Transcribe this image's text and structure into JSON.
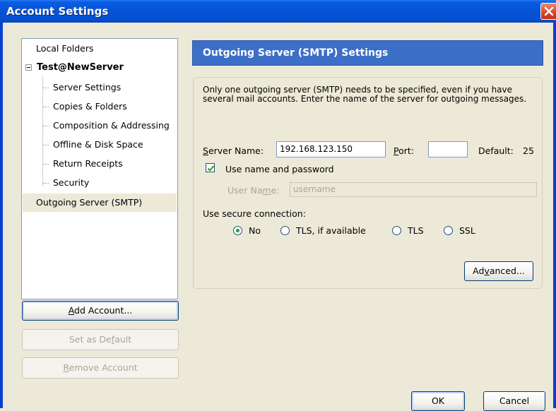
{
  "window": {
    "title": "Account Settings"
  },
  "tree": {
    "local_folders": "Local Folders",
    "account": "Test@NewServer",
    "children": [
      "Server Settings",
      "Copies & Folders",
      "Composition & Addressing",
      "Offline & Disk Space",
      "Return Receipts",
      "Security"
    ],
    "outgoing": "Outgoing Server (SMTP)"
  },
  "left_buttons": {
    "add_account": {
      "pre": "",
      "key": "A",
      "post": "dd Account..."
    },
    "set_default": {
      "pre": "Set as De",
      "key": "f",
      "post": "ault"
    },
    "remove_account": {
      "pre": "",
      "key": "R",
      "post": "emove Account"
    }
  },
  "panel": {
    "header": "Outgoing Server (SMTP) Settings",
    "description": "Only one outgoing server (SMTP) needs to be specified, even if you have several mail accounts. Enter the name of the server for outgoing messages.",
    "server_name_label": {
      "key": "S",
      "rest": "erver Name:"
    },
    "server_name_value": "192.168.123.150",
    "port_label": {
      "key": "P",
      "rest": "ort:"
    },
    "port_value": "",
    "default_label": "Default:",
    "default_value": "25",
    "use_name_password": "Use name and password",
    "use_name_password_checked": true,
    "username_label": {
      "pre": "User Na",
      "key": "m",
      "post": "e:"
    },
    "username_placeholder": "username",
    "secure_label": "Use secure connection:",
    "secure_options": [
      "No",
      "TLS, if available",
      "TLS",
      "SSL"
    ],
    "secure_selected": "No",
    "advanced": {
      "pre": "Ad",
      "key": "v",
      "post": "anced..."
    }
  },
  "footer": {
    "ok": "OK",
    "cancel": "Cancel"
  },
  "colors": {
    "title_bar": "#0854d8",
    "panel_header": "#3b6fc8",
    "radio_dot": "#21a121",
    "dialog_bg": "#ece9d8"
  }
}
